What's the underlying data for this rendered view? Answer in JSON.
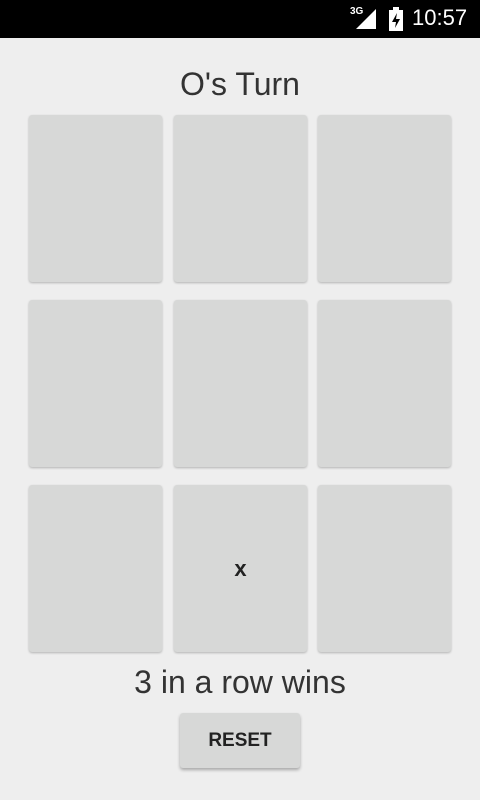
{
  "status_bar": {
    "network": "3G",
    "time": "10:57",
    "icons": [
      "signal-icon",
      "battery-icon"
    ]
  },
  "game": {
    "turn_label": "O's Turn",
    "rule_label": "3 in a row wins",
    "reset_label": "RESET",
    "board": [
      [
        "",
        "",
        ""
      ],
      [
        "",
        "",
        ""
      ],
      [
        "",
        "x",
        ""
      ]
    ]
  },
  "colors": {
    "background": "#eeeeee",
    "cell": "#d7d8d7",
    "status_bar": "#000000",
    "text": "#333333"
  }
}
